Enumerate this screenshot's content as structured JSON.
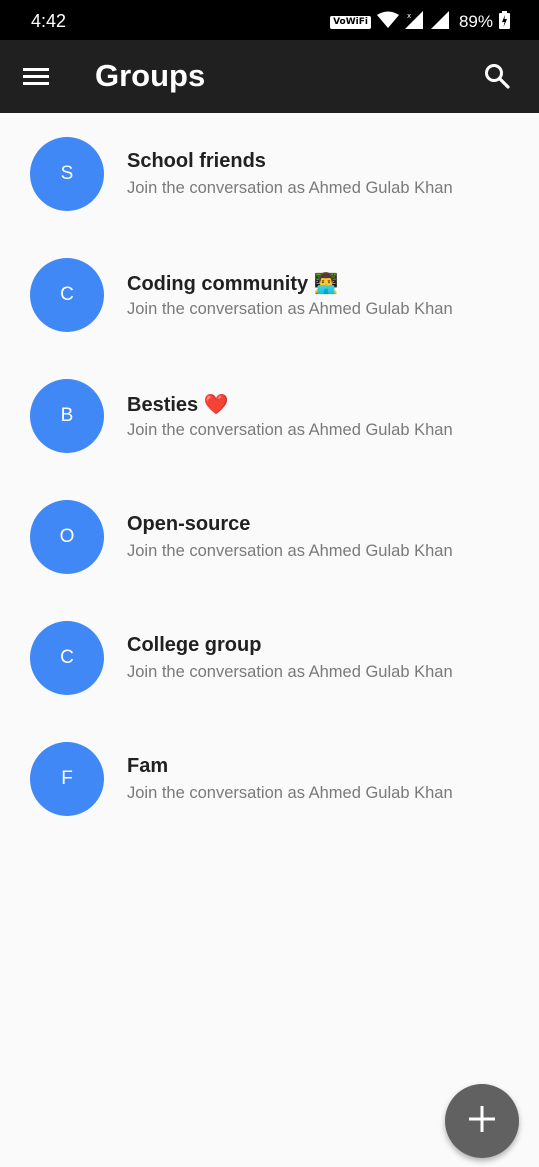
{
  "status_bar": {
    "time": "4:42",
    "volte_label": "VoWiFi",
    "battery_percent": "89%"
  },
  "app_bar": {
    "title": "Groups",
    "menu_icon": "hamburger-menu-icon",
    "search_icon": "search-icon"
  },
  "groups": [
    {
      "initial": "S",
      "name": "School friends",
      "subtitle": "Join the conversation as Ahmed Gulab Khan"
    },
    {
      "initial": "C",
      "name": "Coding community 👨‍💻",
      "subtitle": "Join the conversation as Ahmed Gulab Khan"
    },
    {
      "initial": "B",
      "name": "Besties ❤️",
      "subtitle": "Join the conversation as Ahmed Gulab Khan"
    },
    {
      "initial": "O",
      "name": "Open-source",
      "subtitle": "Join the conversation as Ahmed Gulab Khan"
    },
    {
      "initial": "C",
      "name": "College group",
      "subtitle": "Join the conversation as Ahmed Gulab Khan"
    },
    {
      "initial": "F",
      "name": "Fam",
      "subtitle": "Join the conversation as Ahmed Gulab Khan"
    }
  ],
  "fab": {
    "icon": "plus-icon"
  },
  "colors": {
    "app_bar": "#202020",
    "avatar": "#3f88f5",
    "fab": "#616161",
    "background": "#fafafa"
  }
}
